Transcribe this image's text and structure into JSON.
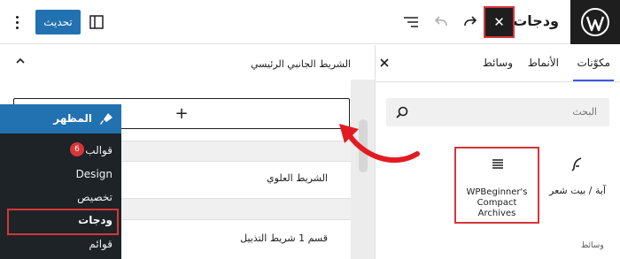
{
  "topbar": {
    "page_title": "ودجات",
    "close_symbol": "✕",
    "update_label": "تحديث",
    "icons": [
      "wordpress-logo-icon",
      "close-icon",
      "redo-icon",
      "undo-icon",
      "list-view-icon",
      "sidebar-toggle-icon",
      "options-icon"
    ]
  },
  "inserter": {
    "tabs": [
      "مكوّنات",
      "الأنماط",
      "وسائط"
    ],
    "active_tab": "مكوّنات",
    "search_placeholder": "البحث",
    "blocks": [
      {
        "label": "WPBeginner's Compact Archives",
        "icon": "list-icon"
      },
      {
        "label": "آية / بيت شعر",
        "icon": "quill-icon"
      }
    ],
    "section_label": "وسائط"
  },
  "editor": {
    "widget_area_title": "الشريط الجانبي الرئيسي",
    "add_symbol": "+",
    "rows": [
      "الشريط العلوي",
      "قسم 1 شريط التذييل"
    ]
  },
  "admin_menu": {
    "header": "المظهر",
    "items": [
      {
        "label": "قوالب",
        "badge": "6"
      },
      {
        "label": "Design"
      },
      {
        "label": "تخصيص"
      },
      {
        "label": "ودجات",
        "current": true
      },
      {
        "label": "قوائم"
      }
    ]
  },
  "colors": {
    "accent": "#2271b1",
    "highlight": "#d63638",
    "dark": "#1e1e1e",
    "admin_bg": "#1d2327"
  }
}
